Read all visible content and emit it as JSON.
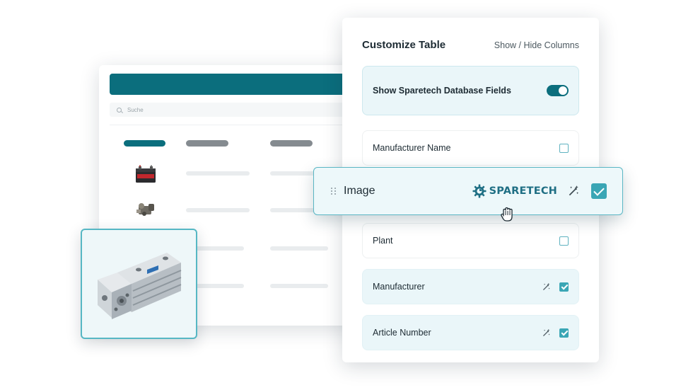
{
  "background_table": {
    "search_placeholder": "Suche"
  },
  "panel": {
    "title": "Customize Table",
    "show_hide_link": "Show / Hide Columns",
    "toggle_row": {
      "label": "Show Sparetech Database Fields",
      "enabled": true
    },
    "fields": [
      {
        "label": "Manufacturer Name",
        "checked": false,
        "ai_icon": false
      },
      {
        "label": "Plant",
        "checked": false,
        "ai_icon": false
      },
      {
        "label": "Manufacturer",
        "checked": true,
        "ai_icon": true
      },
      {
        "label": "Article Number",
        "checked": true,
        "ai_icon": true
      }
    ],
    "dragged_field": {
      "label": "Image",
      "brand": "SPARETECH",
      "checked": true,
      "ai_icon": true
    }
  },
  "icons": [
    "search-icon",
    "drag-handle-icon",
    "sparetech-logo-icon",
    "magic-wand-icon",
    "hand-pointer-icon",
    "car-battery-image",
    "valve-part-image",
    "pneumatic-cylinder-image"
  ],
  "colors": {
    "primary": "#0b6e7d",
    "accent": "#3aa6b5",
    "highlight_bg": "#eaf6f9"
  }
}
